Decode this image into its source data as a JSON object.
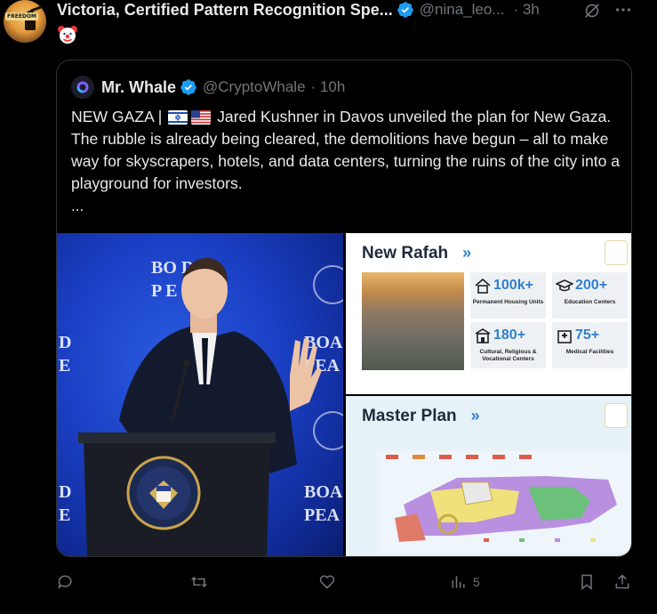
{
  "tweet": {
    "author_name": "Victoria, Certified Pattern Recognition Spe...",
    "handle": "@nina_leo...",
    "time": "· 3h",
    "emoji": "clown-face",
    "avatar_badge": "FREEDOM"
  },
  "quote": {
    "author_name": "Mr. Whale",
    "handle": "@CryptoWhale",
    "time": "· 10h",
    "text_prefix": "NEW GAZA |",
    "text_body": " Jared Kushner in Davos unveiled the plan for New Gaza. The rubble is already being cleared, the demolitions have begun – all to make way for skyscrapers, hotels, and data centers, turning the ruins of the city into a playground for investors.",
    "ellipsis": "...",
    "flags": [
      "israel-flag",
      "us-flag"
    ]
  },
  "media": {
    "photo": {
      "board_text_center": [
        "BO   D",
        "P     E"
      ],
      "board_text_right": [
        "BOA",
        "PEA"
      ],
      "board_text_left": [
        "D",
        "E"
      ]
    },
    "slide1": {
      "title": "New Rafah",
      "chevron": "»",
      "stats": [
        {
          "value": "100k+",
          "label": "Permanent Housing Units",
          "icon": "house-icon"
        },
        {
          "value": "200+",
          "label": "Education Centers",
          "icon": "graduation-cap-icon"
        },
        {
          "value": "180+",
          "label": "Cultural, Religious & Vocational Centers",
          "icon": "building-icon"
        },
        {
          "value": "75+",
          "label": "Medical Facilities",
          "icon": "hospital-icon"
        }
      ]
    },
    "slide2": {
      "title": "Master Plan",
      "chevron": "»"
    }
  },
  "actions": {
    "reply_count": "",
    "retweet_count": "",
    "like_count": "",
    "views_count": "5"
  },
  "colors": {
    "background": "#000000",
    "text": "#e7e9ea",
    "muted": "#71767b",
    "border": "#2f3336",
    "verified": "#1d9bf0",
    "slide_accent": "#2f7fd0"
  }
}
